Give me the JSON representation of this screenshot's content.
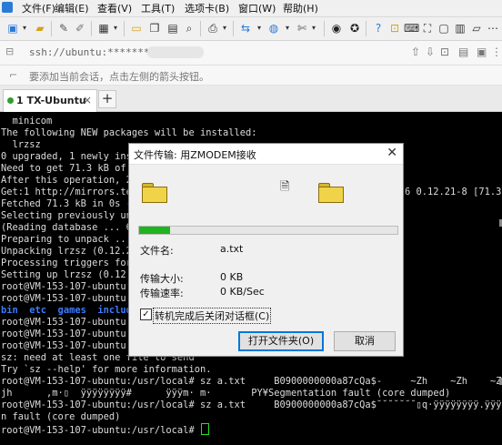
{
  "menu": {
    "items": [
      "文件(F)",
      "编辑(E)",
      "查看(V)",
      "工具(T)",
      "选项卡(B)",
      "窗口(W)",
      "帮助(H)"
    ]
  },
  "toolbar": {
    "icons": [
      "new-session-icon",
      "open-icon",
      "edit-icon",
      "settings-icon",
      "grid-icon",
      "folder-icon",
      "copy-icon",
      "zoom-icon",
      "print-icon",
      "transfer-icon",
      "globe-icon",
      "script-icon",
      "xftp-icon",
      "help-icon",
      "lock-icon",
      "keyboard-icon",
      "fullscreen-icon",
      "window-icon"
    ]
  },
  "address": {
    "url": "ssh://ubuntu:************@"
  },
  "hint": {
    "text": "要添加当前会话，点击左侧的箭头按钮。"
  },
  "tabs": [
    {
      "label": "1 TX-Ubuntu",
      "status_color": "#2f9e2f"
    }
  ],
  "terminal": {
    "lines": [
      "  minicom",
      "The following NEW packages will be installed:",
      "  lrzsz",
      "0 upgraded, 1 newly ins",
      "Need to get 71.3 kB of a",
      "After this operation, 2",
      "Get:1 http://mirrors.ten",
      "Fetched 71.3 kB in 0s (1",
      "Selecting previously un",
      "(Reading database ... 6",
      "Preparing to unpack ...",
      "Unpacking lrzsz (0.12.2",
      "Processing triggers for",
      "Setting up lrzsz (0.12.",
      "root@VM-153-107-ubuntu:",
      "root@VM-153-107-ubuntu:",
      "bin  etc  games  include",
      "root@VM-153-107-ubuntu:",
      "root@VM-153-107-ubuntu:",
      "root@VM-153-107-ubuntu:",
      "sz: need at least one file to send",
      "Try `sz --help' for more information.",
      "root@VM-153-107-ubuntu:/usr/local# sz a.txt     B0900000000a87cQa$-     ~Zh    ~Zh    ~Zh",
      "jh      ,m·▯  ÿÿÿÿÿÿÿÿ#      ÿÿÿm· m·       PY¥Segmentation fault (core dumped)",
      "root@VM-153-107-ubuntu:/usr/local# sz a.txt     B0900000000a87cQa$˘˘˘˘˘˘˘▯q·ÿÿÿÿÿÿÿÿ.ÿÿÿ/Segmentatio",
      "n fault (core dumped)",
      "root@VM-153-107-ubuntu:/usr/local# "
    ],
    "right_fragments": {
      "get_line": "6 0.12.21-8 [71.3"
    }
  },
  "dialog": {
    "title": "文件传输: 用ZMODEM接收",
    "progress": 0.12,
    "progress_color": "#1fb31f",
    "filename_label": "文件名:",
    "filename": "a.txt",
    "size_label": "传输大小:",
    "size": "0 KB",
    "rate_label": "传输速率:",
    "rate": "0 KB/Sec",
    "checkbox_checked": true,
    "checkbox_label": "转机完成后关闭对话框(C)",
    "open_folder_button": "打开文件夹(O)",
    "cancel_button": "取消"
  }
}
